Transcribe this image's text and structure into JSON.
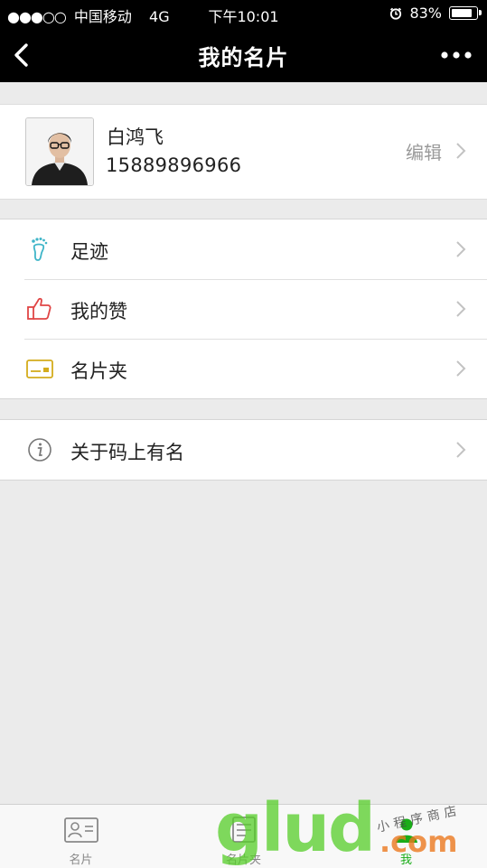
{
  "status_bar": {
    "signal": "●●●○○",
    "carrier": "中国移动",
    "network": "4G",
    "time": "下午10:01",
    "battery_percent": "83%",
    "battery_level": 0.83
  },
  "nav": {
    "title": "我的名片",
    "back_icon": "chevron-left-icon",
    "more_icon": "more-dots-icon"
  },
  "profile": {
    "name": "白鸿飞",
    "phone": "15889896966",
    "edit_label": "编辑"
  },
  "menu_groups": [
    [
      {
        "label": "足迹",
        "icon": "footprint-icon",
        "color": "#3fb5c8"
      },
      {
        "label": "我的赞",
        "icon": "thumbs-up-icon",
        "color": "#e04545"
      },
      {
        "label": "名片夹",
        "icon": "card-holder-icon",
        "color": "#d4ac1c"
      }
    ],
    [
      {
        "label": "关于码上有名",
        "icon": "info-icon",
        "color": "#777777"
      }
    ]
  ],
  "tab_bar": {
    "tabs": [
      {
        "label": "名片",
        "icon": "contact-card-icon"
      },
      {
        "label": "名片夹",
        "icon": "card-folder-icon"
      },
      {
        "label": "我",
        "icon": "person-icon",
        "active": true
      }
    ]
  },
  "watermark": {
    "big": "glud",
    "suffix": ".com",
    "small": "小程序商店"
  },
  "colors": {
    "nav_background": "#000000",
    "page_background": "#ebebeb",
    "active_tab": "#1aad19"
  }
}
